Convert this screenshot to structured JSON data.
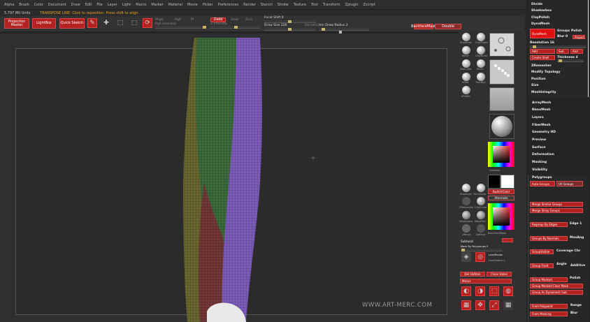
{
  "menu": [
    "Alpha",
    "Brush",
    "Color",
    "Document",
    "Draw",
    "Edit",
    "File",
    "Layer",
    "Light",
    "Macro",
    "Marker",
    "Material",
    "Movie",
    "Picker",
    "Preferences",
    "Render",
    "Stencil",
    "Stroke",
    "Texture",
    "Tool",
    "Transform",
    "Zplugin",
    "Zscript"
  ],
  "info": {
    "points": "5.797 Mil Units",
    "message": "TRANSPOSE LINE: Click to reposition. Press shift to align."
  },
  "toolbar": {
    "projection_master": "Projection Master",
    "lightbox": "LightBox",
    "quick_sketch": "Quick Sketch",
    "edit": "Edit",
    "draw": "Draw",
    "move": "Move",
    "scale": "Scale",
    "rotate": "Rotate",
    "mrgb": "Mrgb",
    "rgb": "Rgb",
    "m": "M",
    "zadd": "Zadd",
    "zsub": "Zsub",
    "zcut": "Zcut",
    "rgb_intensity": "Rgb Intensity",
    "z_intensity": "Z Intensity",
    "focal_shift": "Focal Shift 0",
    "draw_size": "Draw Size 226",
    "dynamic": "Dynamic",
    "hm_radius": "Hm Draw Radius 2",
    "backface_mask": "BackfaceMask",
    "double": "Double"
  },
  "canvas": {
    "watermark": "WWW.ART-MERC.COM"
  },
  "left_palette": {
    "brushes": [
      "Standard",
      "ClayTubes",
      "Move",
      "ClayBuild",
      "Dam_Std",
      "Pinch",
      "Inflat",
      "TrimDyn",
      "hPolish"
    ],
    "gradient": "Gradient",
    "switch_color": "SwitchColor",
    "alternate": "Alternate",
    "brushes2": [
      "Standard",
      "TrimCurve",
      "ZRemesher",
      "ClipCurve",
      "MaskLasso",
      "MaskPen",
      "ZBrush",
      "Default"
    ],
    "backface_mask": "BackFaceMask",
    "subtools": "Subtools",
    "mask_by_polygroups": "Mask By Polygroups 0",
    "lazymouse": "LazyMouse",
    "lazyradius": "LazyRadius 1",
    "del_hidden": "Del Hidden",
    "close_holes": "Close Holes",
    "mirror": "Mirror",
    "bottom_icons": [
      "Brush",
      "Transp",
      "Solo",
      "Ghost",
      "Frame",
      "Move",
      "Scale",
      "Rotate",
      "PolyF"
    ]
  },
  "right_panel": {
    "top_items": [
      "Divide",
      "Shadowbox",
      "ClayPolish",
      "DynaMesh"
    ],
    "dynamesh": "DynaMesh",
    "groups": "Groups",
    "polish": "Polish",
    "blur": "Blur 0",
    "project": "Project",
    "resolution": "Resolution 16",
    "add": "Add",
    "sub": "Sub",
    "and": "And",
    "create_shell": "Create Shell",
    "thickness": "Thickness 4",
    "menu_items": [
      "ZRemesher",
      "Modify Topology",
      "Position",
      "Size",
      "MeshIntegrity",
      "ArrayMesh",
      "NanoMesh",
      "Layers",
      "FiberMesh",
      "Geometry HD",
      "Preview",
      "Surface",
      "Deformation",
      "Masking",
      "Visibility",
      "Polygroups"
    ],
    "polygroups": {
      "auto_groups": "Auto Groups",
      "uv_groups": "UV Groups",
      "merge_similar": "Merge Similar Groups",
      "merge_stray": "Merge Stray Groups",
      "group_by_edges": "Regroup By Edges",
      "edge": "Edge 1",
      "groups_by_normals": "Groups By Normals",
      "max_ang": "MaxAng",
      "group_visible": "GroupVisible",
      "coverage": "Coverage Chr",
      "group_front": "Group Front",
      "angle": "Angle",
      "additive": "Additive",
      "group_masked": "Group Masked",
      "polish": "Polish",
      "group_masked_clear": "Group Masked Clear Mask",
      "group_as_dynamesh": "Group As Dynamesh Sub",
      "from_polypaint": "From Polypaint",
      "from_masking": "From Masking",
      "range": "Range",
      "blur": "Blur"
    }
  }
}
